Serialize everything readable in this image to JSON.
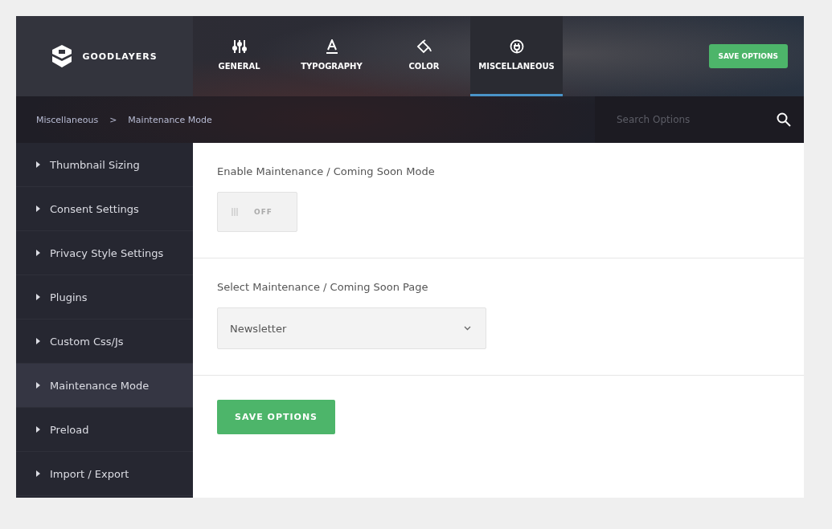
{
  "brand": {
    "name": "GOODLAYERS"
  },
  "tabs": [
    {
      "label": "GENERAL",
      "kind": "sliders",
      "selected": false
    },
    {
      "label": "TYPOGRAPHY",
      "kind": "letter",
      "selected": false
    },
    {
      "label": "COLOR",
      "kind": "bucket",
      "selected": false
    },
    {
      "label": "MISCELLANEOUS",
      "kind": "plug",
      "selected": true
    }
  ],
  "header_button": "SAVE OPTIONS",
  "breadcrumb": [
    "Miscellaneous",
    "Maintenance Mode"
  ],
  "breadcrumb_separator": ">",
  "search": {
    "placeholder": "Search Options"
  },
  "sidebar": {
    "items": [
      {
        "label": "Thumbnail Sizing",
        "selected": false
      },
      {
        "label": "Consent Settings",
        "selected": false
      },
      {
        "label": "Privacy Style Settings",
        "selected": false
      },
      {
        "label": "Plugins",
        "selected": false
      },
      {
        "label": "Custom Css/Js",
        "selected": false
      },
      {
        "label": "Maintenance Mode",
        "selected": true
      },
      {
        "label": "Preload",
        "selected": false
      },
      {
        "label": "Import / Export",
        "selected": false
      }
    ]
  },
  "options": [
    {
      "kind": "toggle",
      "label": "Enable Maintenance / Coming Soon Mode",
      "on": false,
      "state_text": "OFF"
    },
    {
      "kind": "select",
      "label": "Select Maintenance / Coming Soon Page",
      "value": "Newsletter"
    }
  ],
  "save_button": "SAVE OPTIONS"
}
